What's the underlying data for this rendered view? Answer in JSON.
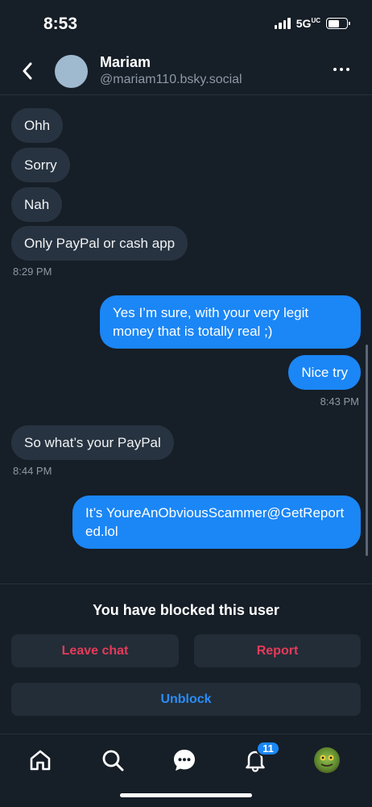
{
  "status_bar": {
    "time": "8:53",
    "network": "5G",
    "network_suffix": "UC"
  },
  "header": {
    "name": "Mariam",
    "handle": "@mariam110.bsky.social"
  },
  "messages": [
    {
      "dir": "in",
      "text": "Ohh"
    },
    {
      "dir": "in",
      "text": "Sorry"
    },
    {
      "dir": "in",
      "text": "Nah"
    },
    {
      "dir": "in",
      "text": "Only PayPal or cash app"
    },
    {
      "dir": "out",
      "text": "Yes I’m sure, with your very legit money that is totally real ;)"
    },
    {
      "dir": "out",
      "text": "Nice try"
    },
    {
      "dir": "in",
      "text": "So what’s your PayPal"
    },
    {
      "dir": "out",
      "text": "It’s YoureAnObviousScammer@GetReported.lol"
    }
  ],
  "timestamps": {
    "t1": "8:29 PM",
    "t2": "8:43 PM",
    "t3": "8:44 PM"
  },
  "blocked": {
    "notice": "You have blocked this user",
    "leave_label": "Leave chat",
    "report_label": "Report",
    "unblock_label": "Unblock"
  },
  "tabbar": {
    "notification_count": "11"
  },
  "colors": {
    "background": "#161e27",
    "incoming_bubble": "#273340",
    "outgoing_bubble": "#1b86f5",
    "danger": "#e63a59",
    "accent": "#2a8cf5"
  },
  "icons": [
    "back-icon",
    "more-icon",
    "home-icon",
    "search-icon",
    "chat-icon",
    "bell-icon",
    "avatar"
  ]
}
